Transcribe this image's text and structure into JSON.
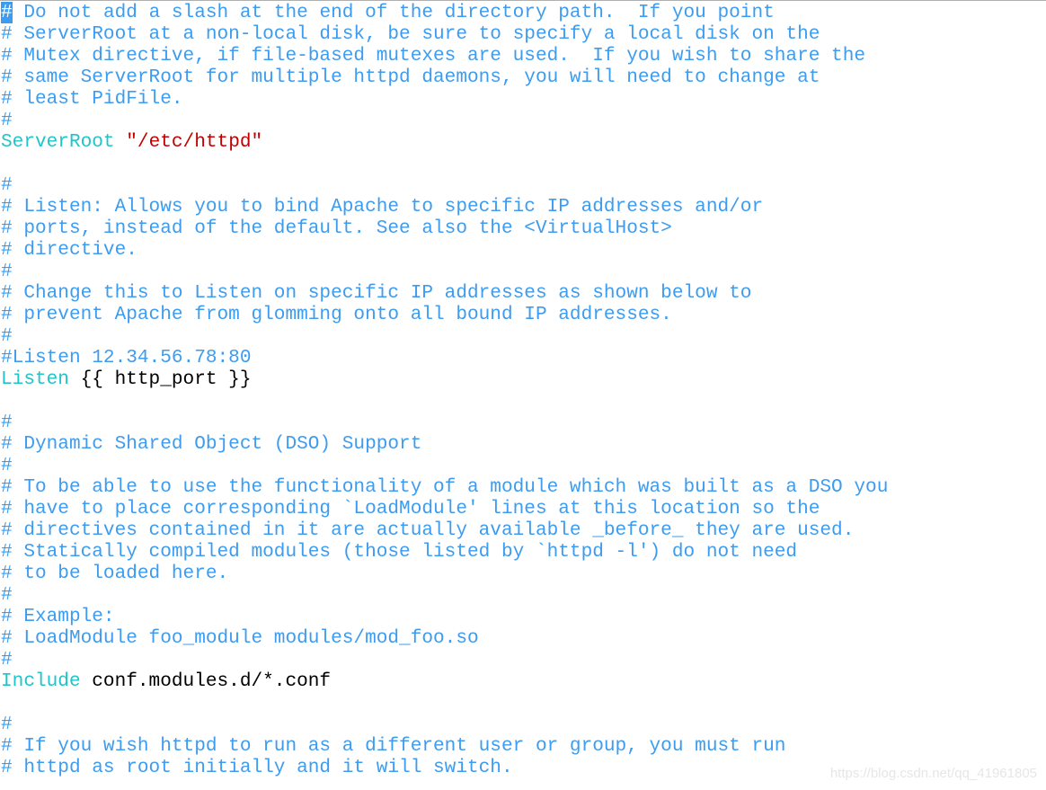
{
  "editor": {
    "colors": {
      "comment": "#3d9cf0",
      "keyword": "#1fc5c8",
      "string": "#c40000",
      "cursor": "#3d9cf0"
    },
    "lines": [
      [
        {
          "t": "#",
          "c": "cursor"
        },
        {
          "t": " Do not add a slash at the end of the directory path.  If you point",
          "c": "comment"
        }
      ],
      [
        {
          "t": "# ServerRoot at a non-local disk, be sure to specify a local disk on the",
          "c": "comment"
        }
      ],
      [
        {
          "t": "# Mutex directive, if file-based mutexes are used.  If you wish to share the",
          "c": "comment"
        }
      ],
      [
        {
          "t": "# same ServerRoot for multiple httpd daemons, you will need to change at",
          "c": "comment"
        }
      ],
      [
        {
          "t": "# least PidFile.",
          "c": "comment"
        }
      ],
      [
        {
          "t": "#",
          "c": "comment"
        }
      ],
      [
        {
          "t": "ServerRoot",
          "c": "keyword"
        },
        {
          "t": " ",
          "c": "normal"
        },
        {
          "t": "\"/etc/httpd\"",
          "c": "string"
        }
      ],
      [],
      [
        {
          "t": "#",
          "c": "comment"
        }
      ],
      [
        {
          "t": "# Listen: Allows you to bind Apache to specific IP addresses and/or",
          "c": "comment"
        }
      ],
      [
        {
          "t": "# ports, instead of the default. See also the <VirtualHost>",
          "c": "comment"
        }
      ],
      [
        {
          "t": "# directive.",
          "c": "comment"
        }
      ],
      [
        {
          "t": "#",
          "c": "comment"
        }
      ],
      [
        {
          "t": "# Change this to Listen on specific IP addresses as shown below to",
          "c": "comment"
        }
      ],
      [
        {
          "t": "# prevent Apache from glomming onto all bound IP addresses.",
          "c": "comment"
        }
      ],
      [
        {
          "t": "#",
          "c": "comment"
        }
      ],
      [
        {
          "t": "#Listen 12.34.56.78:80",
          "c": "comment"
        }
      ],
      [
        {
          "t": "Listen",
          "c": "keyword"
        },
        {
          "t": " {{ http_port }}",
          "c": "normal"
        }
      ],
      [],
      [
        {
          "t": "#",
          "c": "comment"
        }
      ],
      [
        {
          "t": "# Dynamic Shared Object (DSO) Support",
          "c": "comment"
        }
      ],
      [
        {
          "t": "#",
          "c": "comment"
        }
      ],
      [
        {
          "t": "# To be able to use the functionality of a module which was built as a DSO you",
          "c": "comment"
        }
      ],
      [
        {
          "t": "# have to place corresponding `LoadModule' lines at this location so the",
          "c": "comment"
        }
      ],
      [
        {
          "t": "# directives contained in it are actually available _before_ they are used.",
          "c": "comment"
        }
      ],
      [
        {
          "t": "# Statically compiled modules (those listed by `httpd -l') do not need",
          "c": "comment"
        }
      ],
      [
        {
          "t": "# to be loaded here.",
          "c": "comment"
        }
      ],
      [
        {
          "t": "#",
          "c": "comment"
        }
      ],
      [
        {
          "t": "# Example:",
          "c": "comment"
        }
      ],
      [
        {
          "t": "# LoadModule foo_module modules/mod_foo.so",
          "c": "comment"
        }
      ],
      [
        {
          "t": "#",
          "c": "comment"
        }
      ],
      [
        {
          "t": "Include",
          "c": "keyword"
        },
        {
          "t": " conf.modules.d/*.conf",
          "c": "normal"
        }
      ],
      [],
      [
        {
          "t": "#",
          "c": "comment"
        }
      ],
      [
        {
          "t": "# If you wish httpd to run as a different user or group, you must run",
          "c": "comment"
        }
      ],
      [
        {
          "t": "# httpd as root initially and it will switch.",
          "c": "comment"
        }
      ]
    ]
  },
  "watermark": "https://blog.csdn.net/qq_41961805"
}
